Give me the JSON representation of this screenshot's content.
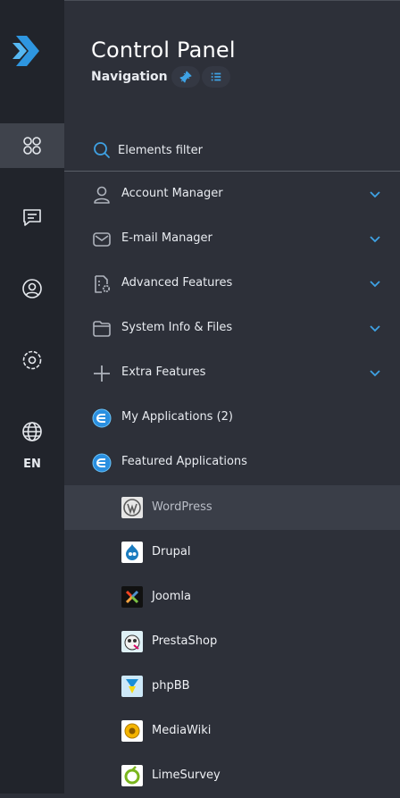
{
  "header": {
    "title": "Control Panel",
    "subtitle": "Navigation"
  },
  "rail": {
    "language": "EN",
    "active_index": 0,
    "icons": [
      "dashboard-icon",
      "chat-icon",
      "user-icon",
      "settings-icon",
      "globe-icon"
    ]
  },
  "filter": {
    "placeholder": "Elements filter"
  },
  "menu": [
    {
      "label": "Account Manager",
      "icon": "user-icon"
    },
    {
      "label": "E-mail Manager",
      "icon": "mail-icon"
    },
    {
      "label": "Advanced Features",
      "icon": "file-gear-icon"
    },
    {
      "label": "System Info & Files",
      "icon": "folder-icon"
    },
    {
      "label": "Extra Features",
      "icon": "plus-icon"
    },
    {
      "label": "My Applications (2)",
      "icon": "app-installer-icon"
    },
    {
      "label": "Featured Applications",
      "icon": "app-installer-icon"
    }
  ],
  "apps": [
    {
      "label": "WordPress",
      "icon": "wordpress-icon"
    },
    {
      "label": "Drupal",
      "icon": "drupal-icon"
    },
    {
      "label": "Joomla",
      "icon": "joomla-icon"
    },
    {
      "label": "PrestaShop",
      "icon": "prestashop-icon"
    },
    {
      "label": "phpBB",
      "icon": "phpbb-icon"
    },
    {
      "label": "MediaWiki",
      "icon": "mediawiki-icon"
    },
    {
      "label": "LimeSurvey",
      "icon": "limesurvey-icon"
    }
  ],
  "colors": {
    "accent": "#3fa2e4",
    "rail_bg": "#21242b",
    "panel_bg": "#2d3039",
    "highlight_bg": "#3a3e48"
  }
}
